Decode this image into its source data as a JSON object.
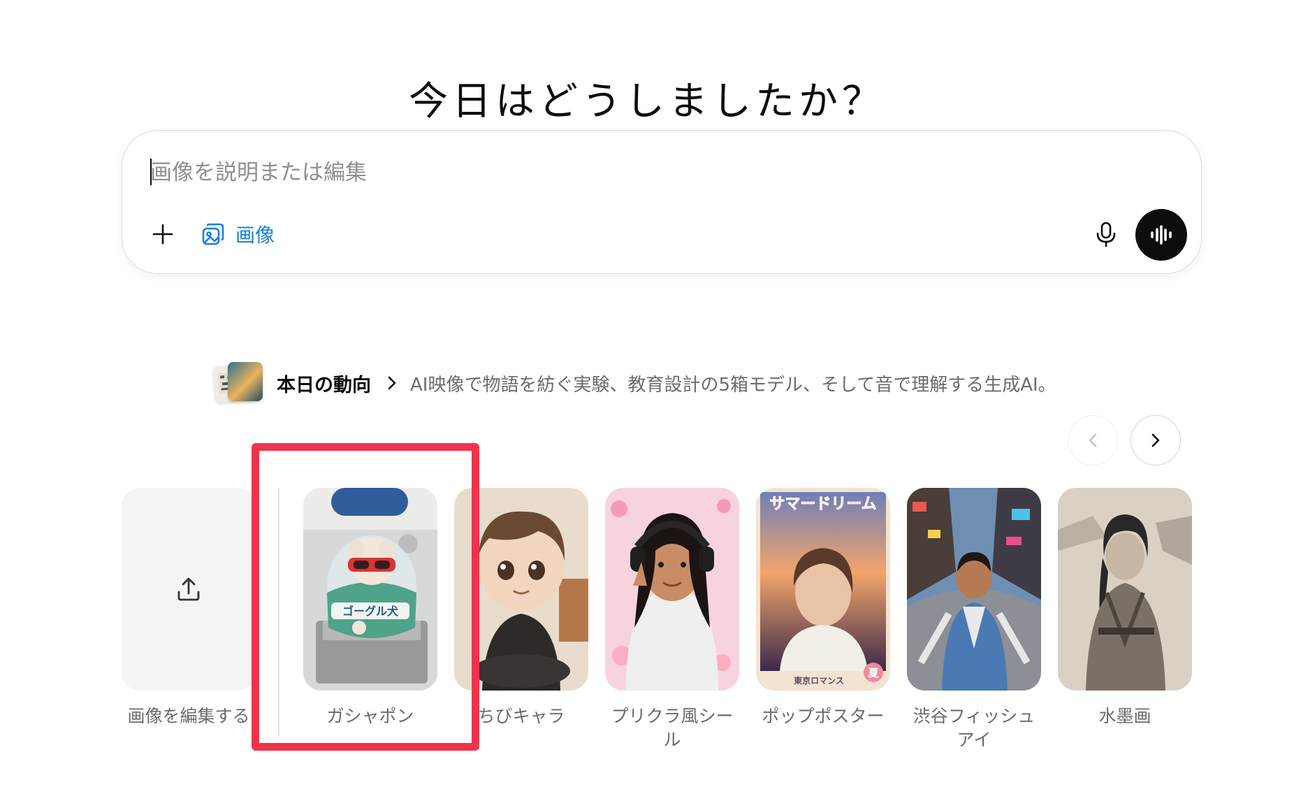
{
  "heading": "今日はどうしましたか？",
  "composer": {
    "placeholder": "画像を説明または編集",
    "add_icon": "plus-icon",
    "image_chip_icon": "images-icon",
    "image_chip_label": "画像",
    "mic_icon": "microphone-icon",
    "voice_icon": "voice-waveform-icon"
  },
  "trending": {
    "title": "本日の動向",
    "chevron_icon": "chevron-right-icon",
    "description": "AI映像で物語を紡ぐ実験、教育設計の5箱モデル、そして音で理解する生成AI。"
  },
  "carousel": {
    "prev_icon": "chevron-left-icon",
    "next_icon": "chevron-right-icon",
    "items": [
      {
        "label": "画像を編集する",
        "icon": "upload-icon"
      },
      {
        "label": "ガシャポン",
        "thumb_text": "ゴーグル犬"
      },
      {
        "label": "ちびキャラ"
      },
      {
        "label": "プリクラ風シール"
      },
      {
        "label": "ポップポスター",
        "thumb_title": "サマードリーム",
        "thumb_footer": "東京ロマンス",
        "thumb_badge": "夏"
      },
      {
        "label": "渋谷フィッシュアイ"
      },
      {
        "label": "水墨画"
      }
    ]
  },
  "colors": {
    "accent": "#1a7fe0",
    "highlight": "#f0334a",
    "voice_button": "#0d0d0d"
  }
}
